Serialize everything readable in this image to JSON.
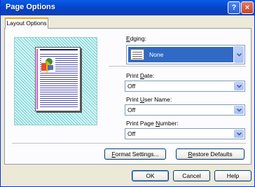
{
  "window": {
    "title": "Page Options",
    "help_glyph": "?",
    "close_glyph": "×"
  },
  "tabs": [
    {
      "label": "Layout Options",
      "active": true
    }
  ],
  "edging": {
    "label_pre": "",
    "label_key": "E",
    "label_post": "dging:",
    "value": "None"
  },
  "print_date": {
    "label_pre": "Print ",
    "label_key": "D",
    "label_post": "ate:",
    "value": "Off"
  },
  "print_user_name": {
    "label_pre": "Print ",
    "label_key": "U",
    "label_post": "ser Name:",
    "value": "Off"
  },
  "print_page_number": {
    "label_pre": "Print Page ",
    "label_key": "N",
    "label_post": "umber:",
    "value": "Off"
  },
  "buttons": {
    "format_settings": {
      "key": "F",
      "rest": "ormat Settings..."
    },
    "restore_defaults": {
      "key": "R",
      "rest": "estore Defaults"
    },
    "ok": "OK",
    "cancel": "Cancel",
    "help": "Help"
  },
  "colors": {
    "title_bar": "#0a5ce8",
    "selection": "#316ac5",
    "tab_accent": "#f5a71f",
    "preview_hatch": "#69d3d6"
  }
}
